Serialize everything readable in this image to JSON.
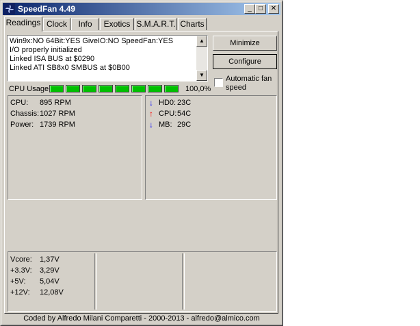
{
  "window": {
    "title": "SpeedFan 4.49"
  },
  "titlebar_buttons": {
    "minimize": "_",
    "maximize": "□",
    "close": "✕"
  },
  "tabs": [
    {
      "label": "Readings"
    },
    {
      "label": "Clock"
    },
    {
      "label": "Info"
    },
    {
      "label": "Exotics"
    },
    {
      "label": "S.M.A.R.T."
    },
    {
      "label": "Charts"
    }
  ],
  "active_tab": "Readings",
  "log": {
    "lines": [
      "Win9x:NO  64Bit:YES  GiveIO:NO  SpeedFan:YES",
      "I/O properly initialized",
      "Linked ISA BUS at $0290",
      "Linked ATI SB8x0 SMBUS at $0B00"
    ]
  },
  "buttons": {
    "minimize": "Minimize",
    "configure": "Configure"
  },
  "auto_fan": {
    "label": "Automatic fan speed",
    "checked": false
  },
  "cpu_usage": {
    "label": "CPU Usage",
    "percent": "100,0%",
    "bars": 8
  },
  "fans": [
    {
      "name": "CPU:",
      "value": "895 RPM"
    },
    {
      "name": "Chassis:",
      "value": "1027 RPM"
    },
    {
      "name": "Power:",
      "value": "1739 RPM"
    }
  ],
  "temps": [
    {
      "name": "HD0:",
      "value": "23C",
      "trend": "down",
      "color": "#0000ff"
    },
    {
      "name": "CPU:",
      "value": "54C",
      "trend": "up",
      "color": "#ff0000"
    },
    {
      "name": "MB:",
      "value": "29C",
      "trend": "down",
      "color": "#0000ff"
    }
  ],
  "voltages": [
    {
      "name": "Vcore:",
      "value": "1,37V"
    },
    {
      "name": "+3.3V:",
      "value": "3,29V"
    },
    {
      "name": "+5V:",
      "value": "5,04V"
    },
    {
      "name": "+12V:",
      "value": "12,08V"
    }
  ],
  "footer": "Coded by Alfredo Milani Comparetti - 2000-2013 - alfredo@almico.com"
}
